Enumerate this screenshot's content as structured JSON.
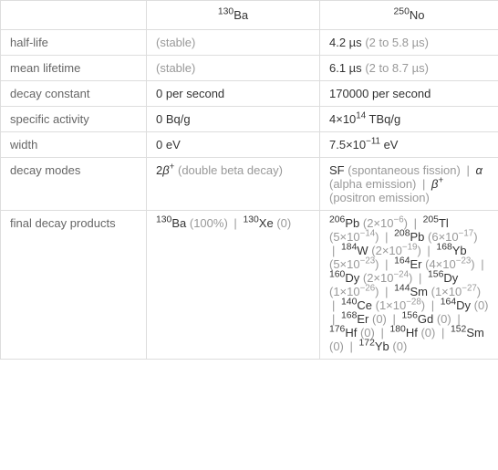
{
  "headers": {
    "ba": {
      "mass": "130",
      "symbol": "Ba"
    },
    "no": {
      "mass": "250",
      "symbol": "No"
    }
  },
  "rows": {
    "half_life": {
      "label": "half-life",
      "ba_stable": "(stable)",
      "no_val": "4.2 µs",
      "no_range": "(2 to 5.8 µs)"
    },
    "mean_lifetime": {
      "label": "mean lifetime",
      "ba_stable": "(stable)",
      "no_val": "6.1 µs",
      "no_range": "(2 to 8.7 µs)"
    },
    "decay_constant": {
      "label": "decay constant",
      "ba": "0 per second",
      "no": "170000 per second"
    },
    "specific_activity": {
      "label": "specific activity",
      "ba": "0 Bq/g",
      "no_pre": "4×10",
      "no_exp": "14",
      "no_post": " TBq/g"
    },
    "width": {
      "label": "width",
      "ba": "0 eV",
      "no_pre": "7.5×10",
      "no_exp": "−11",
      "no_post": " eV"
    },
    "decay_modes": {
      "label": "decay modes",
      "ba_pre": "2",
      "ba_beta": "β",
      "ba_sup": "+",
      "ba_desc": " (double beta decay)",
      "no_sf": "SF",
      "no_sf_desc": " (spontaneous fission)",
      "no_alpha": "α",
      "no_alpha_desc": " (alpha emission)",
      "no_beta": "β",
      "no_beta_sup": "+",
      "no_beta_desc": " (positron emission)"
    },
    "final_decay_products": {
      "label": "final decay products",
      "ba": {
        "p1_mass": "130",
        "p1_sym": "Ba",
        "p1_pct": "(100%)",
        "p2_mass": "130",
        "p2_sym": "Xe",
        "p2_pct": "(0)"
      },
      "no": {
        "items": [
          {
            "mass": "206",
            "sym": "Pb",
            "val_pre": "(2×10",
            "val_exp": "−6",
            "val_post": ")"
          },
          {
            "mass": "205",
            "sym": "Tl",
            "val_pre": "(5×10",
            "val_exp": "−14",
            "val_post": ")"
          },
          {
            "mass": "208",
            "sym": "Pb",
            "val_pre": "(6×10",
            "val_exp": "−17",
            "val_post": ")"
          },
          {
            "mass": "184",
            "sym": "W",
            "val_pre": "(2×10",
            "val_exp": "−19",
            "val_post": ")"
          },
          {
            "mass": "168",
            "sym": "Yb",
            "val_pre": "(5×10",
            "val_exp": "−23",
            "val_post": ")"
          },
          {
            "mass": "164",
            "sym": "Er",
            "val_pre": "(4×10",
            "val_exp": "−23",
            "val_post": ")"
          },
          {
            "mass": "160",
            "sym": "Dy",
            "val_pre": "(2×10",
            "val_exp": "−24",
            "val_post": ")"
          },
          {
            "mass": "156",
            "sym": "Dy",
            "val_pre": "(1×10",
            "val_exp": "−26",
            "val_post": ")"
          },
          {
            "mass": "144",
            "sym": "Sm",
            "val_pre": "(1×10",
            "val_exp": "−27",
            "val_post": ")"
          },
          {
            "mass": "140",
            "sym": "Ce",
            "val_pre": "(1×10",
            "val_exp": "−28",
            "val_post": ")"
          },
          {
            "mass": "164",
            "sym": "Dy",
            "val_plain": "(0)"
          },
          {
            "mass": "168",
            "sym": "Er",
            "val_plain": "(0)"
          },
          {
            "mass": "156",
            "sym": "Gd",
            "val_plain": "(0)"
          },
          {
            "mass": "176",
            "sym": "Hf",
            "val_plain": "(0)"
          },
          {
            "mass": "180",
            "sym": "Hf",
            "val_plain": "(0)"
          },
          {
            "mass": "152",
            "sym": "Sm",
            "val_plain": "(0)"
          },
          {
            "mass": "172",
            "sym": "Yb",
            "val_plain": "(0)"
          }
        ]
      }
    }
  }
}
